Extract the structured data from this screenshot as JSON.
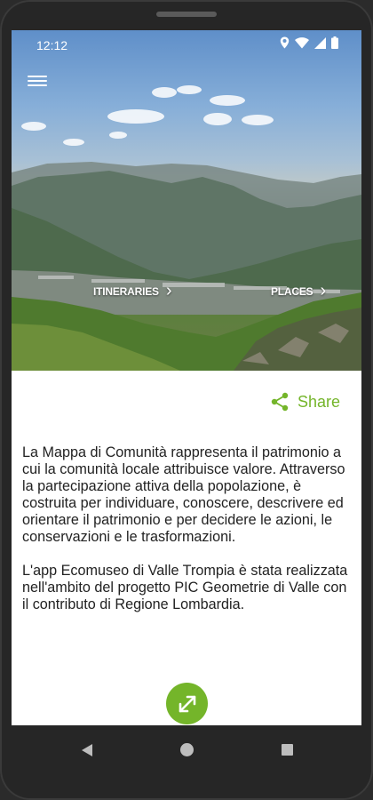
{
  "status": {
    "time": "12:12"
  },
  "hero": {
    "itineraries_label": "ITINERARIES",
    "places_label": "PLACES"
  },
  "share": {
    "label": "Share"
  },
  "description": {
    "paragraph1": "La Mappa di Comunità rappresenta il patrimonio a cui la comunità locale attribuisce valore. Attraverso la partecipazione attiva della popolazione, è costruita per individuare, conoscere, descrivere ed orientare il patrimonio e per decidere le azioni, le conservazioni e le trasformazioni.",
    "paragraph2": "L'app Ecomuseo di Valle Trompia è stata realizzata nell'ambito del progetto PIC Geometrie di Valle con il contributo di Regione Lombardia."
  },
  "icons": {
    "menu": "hamburger-menu-icon",
    "share": "share-icon",
    "expand": "expand-icon",
    "back": "back-triangle-icon",
    "home": "home-circle-icon",
    "recent": "recent-square-icon"
  },
  "colors": {
    "accent": "#74b52a"
  }
}
